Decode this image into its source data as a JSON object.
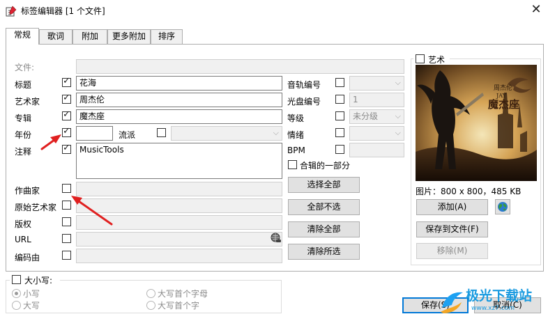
{
  "window": {
    "title": "标签编辑器 [1 个文件]",
    "close_glyph": "✕"
  },
  "tabs": [
    "常规",
    "歌词",
    "附加",
    "更多附加",
    "排序"
  ],
  "fields": {
    "file": {
      "label": "文件:",
      "value": ""
    },
    "title": {
      "label": "标题",
      "value": "花海",
      "checked": true
    },
    "artist": {
      "label": "艺术家",
      "value": "周杰伦",
      "checked": true
    },
    "album": {
      "label": "专辑",
      "value": "魔杰座",
      "checked": true
    },
    "year": {
      "label": "年份",
      "value": "",
      "checked": true
    },
    "genre": {
      "label": "流派",
      "value": "",
      "checked": false
    },
    "comment": {
      "label": "注释",
      "value": "MusicTools",
      "checked": true
    },
    "composer": {
      "label": "作曲家",
      "checked": false
    },
    "orig_artist": {
      "label": "原始艺术家",
      "checked": false
    },
    "copyright": {
      "label": "版权",
      "checked": false
    },
    "url": {
      "label": "URL",
      "checked": false
    },
    "encoded_by": {
      "label": "编码由",
      "checked": false
    }
  },
  "right_fields": {
    "track": {
      "label": "音轨编号",
      "value": ""
    },
    "disc": {
      "label": "光盘编号",
      "value": "1"
    },
    "rating": {
      "label": "等级",
      "value": "未分级"
    },
    "mood": {
      "label": "情绪",
      "value": ""
    },
    "bpm": {
      "label": "BPM",
      "value": ""
    },
    "compilation": {
      "label": "合辑的一部分"
    }
  },
  "buttons": {
    "select_all": "选择全部",
    "deselect_all": "全部不选",
    "clear_all": "清除全部",
    "clear_selected": "清除所选"
  },
  "art": {
    "label": "艺术",
    "info": "图片：800 x 800，485 KB",
    "add": "添加(A)",
    "save_to_file": "保存到文件(F)",
    "remove": "移除(M)",
    "cover_artist": "周杰伦",
    "cover_sub": "JAY",
    "cover_title": "魔杰座"
  },
  "case": {
    "label": "大小写:",
    "options": [
      "小写",
      "大写",
      "大写首个字母",
      "大写首个字"
    ]
  },
  "footer": {
    "save": "保存(S)",
    "cancel": "取消(C)"
  },
  "watermark": {
    "text": "极光下载站",
    "url": "www.xz7.com"
  },
  "colors": {
    "accent": "#0078d7",
    "arrow": "#e02020"
  }
}
